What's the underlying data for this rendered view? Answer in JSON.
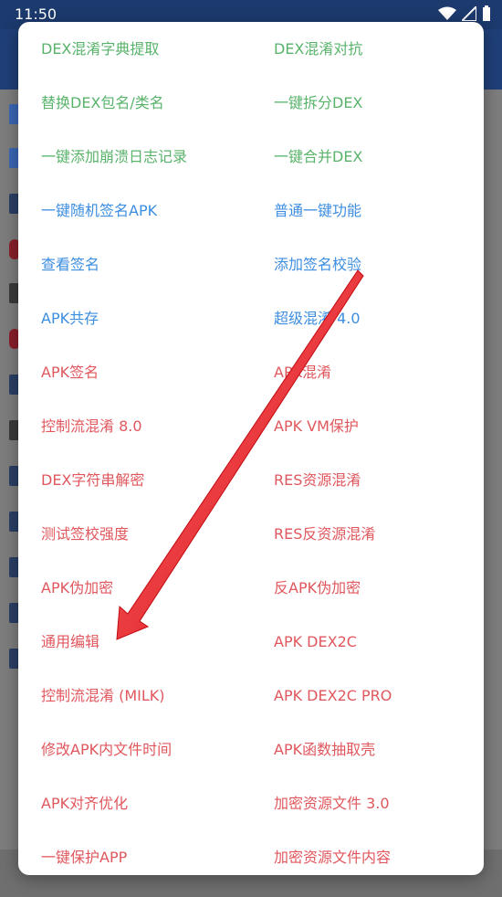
{
  "statusbar": {
    "time": "11:50"
  },
  "colors": {
    "green": "#59b36b",
    "blue": "#3d8ee0",
    "red": "#e0575d",
    "arrow": "#e3131b"
  },
  "menu": {
    "items": [
      {
        "label": "DEX混淆字典提取",
        "color": "green"
      },
      {
        "label": "DEX混淆对抗",
        "color": "green"
      },
      {
        "label": "替换DEX包名/类名",
        "color": "green"
      },
      {
        "label": "一键拆分DEX",
        "color": "green"
      },
      {
        "label": "一键添加崩溃日志记录",
        "color": "green"
      },
      {
        "label": "一键合并DEX",
        "color": "green"
      },
      {
        "label": "一键随机签名APK",
        "color": "blue"
      },
      {
        "label": "普通一键功能",
        "color": "blue"
      },
      {
        "label": "查看签名",
        "color": "blue"
      },
      {
        "label": "添加签名校验",
        "color": "blue"
      },
      {
        "label": "APK共存",
        "color": "blue"
      },
      {
        "label": "超级混淆 4.0",
        "color": "blue"
      },
      {
        "label": "APK签名",
        "color": "red"
      },
      {
        "label": "APK混淆",
        "color": "red"
      },
      {
        "label": "控制流混淆 8.0",
        "color": "red"
      },
      {
        "label": "APK VM保护",
        "color": "red"
      },
      {
        "label": "DEX字符串解密",
        "color": "red"
      },
      {
        "label": "RES资源混淆",
        "color": "red"
      },
      {
        "label": "测试签校强度",
        "color": "red"
      },
      {
        "label": "RES反资源混淆",
        "color": "red"
      },
      {
        "label": "APK伪加密",
        "color": "red"
      },
      {
        "label": "反APK伪加密",
        "color": "red"
      },
      {
        "label": "通用编辑",
        "color": "red"
      },
      {
        "label": "APK DEX2C",
        "color": "red"
      },
      {
        "label": "控制流混淆 (MILK)",
        "color": "red"
      },
      {
        "label": "APK DEX2C PRO",
        "color": "red"
      },
      {
        "label": "修改APK内文件时间",
        "color": "red"
      },
      {
        "label": "APK函数抽取壳",
        "color": "red"
      },
      {
        "label": "APK对齐优化",
        "color": "red"
      },
      {
        "label": "加密资源文件 3.0",
        "color": "red"
      },
      {
        "label": "一键保护APP",
        "color": "red"
      },
      {
        "label": "加密资源文件内容",
        "color": "red"
      }
    ]
  }
}
